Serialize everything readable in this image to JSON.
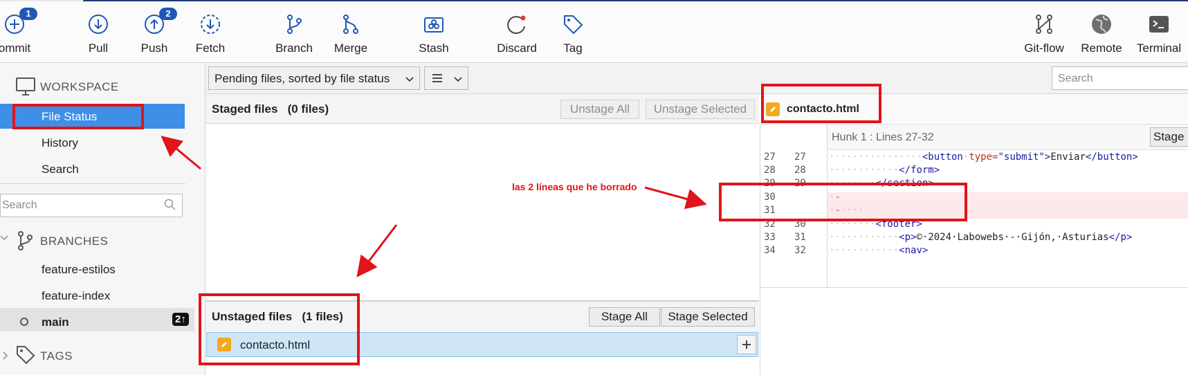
{
  "toolbar": {
    "commit": {
      "label": "ommit",
      "badge": "1"
    },
    "pull": {
      "label": "Pull"
    },
    "push": {
      "label": "Push",
      "badge": "2"
    },
    "fetch": {
      "label": "Fetch"
    },
    "branch": {
      "label": "Branch"
    },
    "merge": {
      "label": "Merge"
    },
    "stash": {
      "label": "Stash"
    },
    "discard": {
      "label": "Discard"
    },
    "tag": {
      "label": "Tag"
    },
    "gitflow": {
      "label": "Git-flow"
    },
    "remote": {
      "label": "Remote"
    },
    "terminal": {
      "label": "Terminal"
    }
  },
  "sidebar": {
    "workspace": "WORKSPACE",
    "file_status": "File Status",
    "history": "History",
    "search": "Search",
    "search_placeholder": "Search",
    "branches": "BRANCHES",
    "branch_items": [
      "feature-estilos",
      "feature-index",
      "main"
    ],
    "main_badge": "2↑",
    "tags": "TAGS"
  },
  "filter": {
    "sort_label": "Pending files, sorted by file status",
    "view_icon": "list-icon",
    "search_placeholder": "Search"
  },
  "staged": {
    "title": "Staged files",
    "count": "(0 files)",
    "unstage_all": "Unstage All",
    "unstage_selected": "Unstage Selected"
  },
  "unstaged": {
    "title": "Unstaged files",
    "count": "(1 files)",
    "stage_all": "Stage All",
    "stage_selected": "Stage Selected",
    "file": "contacto.html"
  },
  "diff": {
    "file": "contacto.html",
    "hunk": "Hunk 1 : Lines 27-32",
    "stage_hunk": "Stage h",
    "lines": [
      {
        "old": "27",
        "new": "27"
      },
      {
        "old": "28",
        "new": "28"
      },
      {
        "old": "29",
        "new": "29"
      },
      {
        "old": "30",
        "new": ""
      },
      {
        "old": "31",
        "new": ""
      },
      {
        "old": "32",
        "new": "30"
      },
      {
        "old": "33",
        "new": "31"
      },
      {
        "old": "34",
        "new": "32"
      }
    ],
    "code": {
      "l27_tag_open": "<button",
      "l27_attr": "type=",
      "l27_str": "\"submit\"",
      "l27_gt": ">",
      "l27_text": "Enviar",
      "l27_close": "</button>",
      "l28": "</form>",
      "l29": "</section>",
      "l30": "-",
      "l31": "-",
      "l32": "<footer>",
      "l33_open": "<p>",
      "l33_text": "©·2024·Labowebs·-·Gijón,·Asturias",
      "l33_close": "</p>",
      "l34": "<nav>"
    }
  },
  "annotation": {
    "text": "las 2 líneas que he borrado"
  },
  "colors": {
    "accent": "#3d8fe8",
    "annotation": "#e0141a",
    "badge": "#1f57b5"
  }
}
